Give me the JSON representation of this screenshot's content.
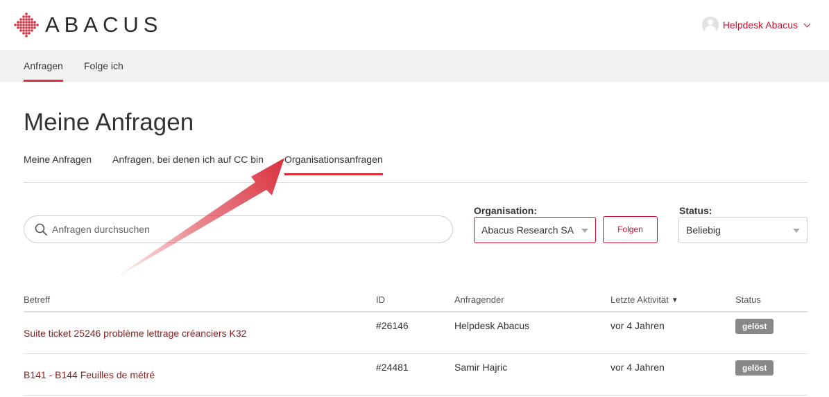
{
  "brand": {
    "name": "ABACUS",
    "accent": "#c8102e"
  },
  "user": {
    "name": "Helpdesk Abacus",
    "icon": "user-avatar-icon",
    "menu_icon": "chevron-down-icon"
  },
  "nav": {
    "items": [
      {
        "label": "Anfragen",
        "active": true
      },
      {
        "label": "Folge ich",
        "active": false
      }
    ]
  },
  "page": {
    "title": "Meine Anfragen"
  },
  "subtabs": [
    {
      "label": "Meine Anfragen",
      "active": false
    },
    {
      "label": "Anfragen, bei denen ich auf CC bin",
      "active": false
    },
    {
      "label": "Organisationsanfragen",
      "active": true
    }
  ],
  "search": {
    "placeholder": "Anfragen durchsuchen",
    "value": "",
    "icon": "search-icon"
  },
  "filters": {
    "organisation": {
      "label": "Organisation:",
      "value": "Abacus Research SA"
    },
    "follow_button": "Folgen",
    "status": {
      "label": "Status:",
      "value": "Beliebig"
    }
  },
  "table": {
    "columns": {
      "subject": "Betreff",
      "id": "ID",
      "requester": "Anfragender",
      "activity": "Letzte Aktivität",
      "status": "Status"
    },
    "sort_indicator": "▼",
    "rows": [
      {
        "subject": "Suite ticket 25246 problème lettrage créanciers K32",
        "id": "#26146",
        "requester": "Helpdesk Abacus",
        "activity": "vor 4 Jahren",
        "status": "gelöst"
      },
      {
        "subject": "B141 - B144 Feuilles de métré",
        "id": "#24481",
        "requester": "Samir Hajric",
        "activity": "vor 4 Jahren",
        "status": "gelöst"
      }
    ]
  },
  "annotation": {
    "icon": "pointer-arrow-icon",
    "color": "#d9303e"
  }
}
